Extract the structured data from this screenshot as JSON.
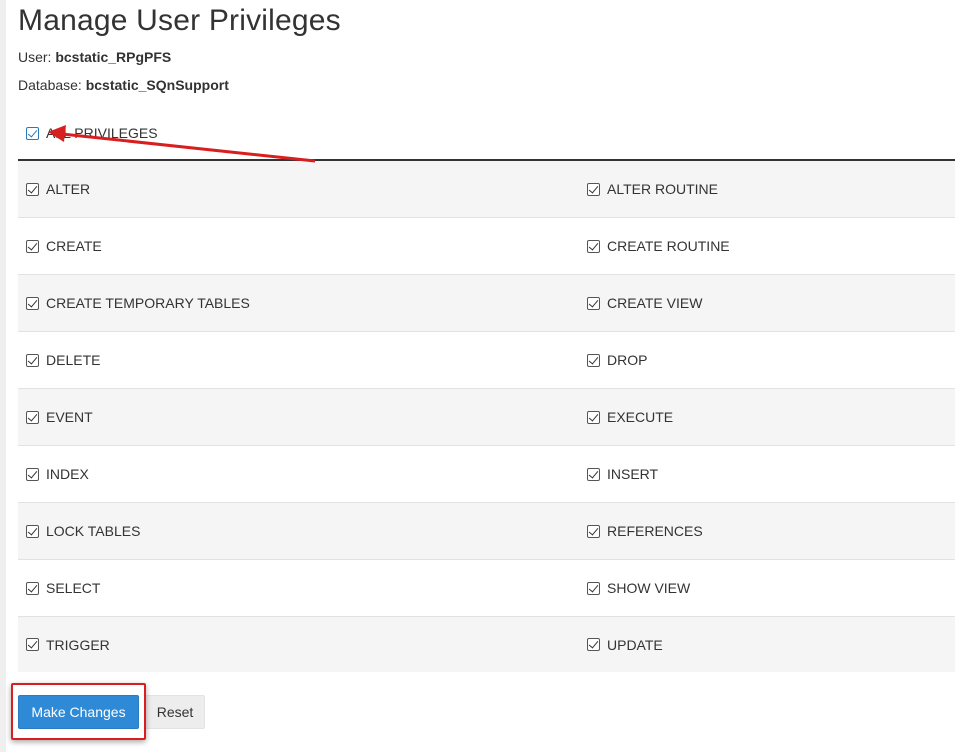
{
  "page": {
    "title": "Manage User Privileges",
    "user_label": "User:",
    "user_value": "bcstatic_RPgPFS",
    "database_label": "Database:",
    "database_value": "bcstatic_SQnSupport"
  },
  "all_privileges": {
    "label": "ALL PRIVILEGES",
    "checked": true
  },
  "privileges": [
    {
      "left": "ALTER",
      "right": "ALTER ROUTINE"
    },
    {
      "left": "CREATE",
      "right": "CREATE ROUTINE"
    },
    {
      "left": "CREATE TEMPORARY TABLES",
      "right": "CREATE VIEW"
    },
    {
      "left": "DELETE",
      "right": "DROP"
    },
    {
      "left": "EVENT",
      "right": "EXECUTE"
    },
    {
      "left": "INDEX",
      "right": "INSERT"
    },
    {
      "left": "LOCK TABLES",
      "right": "REFERENCES"
    },
    {
      "left": "SELECT",
      "right": "SHOW VIEW"
    },
    {
      "left": "TRIGGER",
      "right": "UPDATE"
    }
  ],
  "buttons": {
    "make_changes": "Make Changes",
    "reset": "Reset"
  },
  "colors": {
    "primary_button": "#2e8ad6",
    "annotation_red": "#d81e1e"
  }
}
